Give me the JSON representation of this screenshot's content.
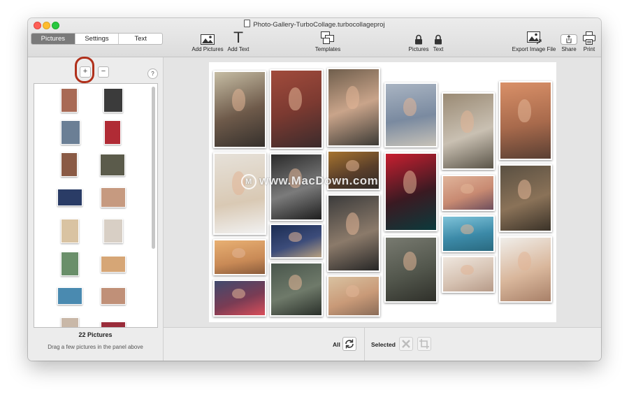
{
  "window": {
    "title": "Photo-Gallery-TurboCollage.turbocollageproj"
  },
  "tabs": [
    "Pictures",
    "Settings",
    "Text"
  ],
  "toolbar": {
    "add_pictures": "Add Pictures",
    "add_text": "Add Text",
    "templates": "Templates",
    "lock_pictures": "Pictures",
    "lock_text": "Text",
    "export": "Export Image File",
    "share": "Share",
    "print": "Print"
  },
  "sidebar": {
    "add_symbol": "+",
    "remove_symbol": "−",
    "help_symbol": "?",
    "count": "22 Pictures",
    "hint": "Drag a few pictures in the panel above"
  },
  "watermark": {
    "logo": "M",
    "text": "www.MacDown.com"
  },
  "bottom": {
    "all_label": "All",
    "selected_label": "Selected"
  },
  "icons": [
    "document-icon",
    "image-icon",
    "text-icon",
    "templates-icon",
    "lock-icon",
    "export-image-icon",
    "share-icon",
    "print-icon",
    "shuffle-icon",
    "delete-icon",
    "crop-icon"
  ],
  "colors": {
    "active_tab": "#7a7a7a",
    "highlight_ring": "#b0301b"
  }
}
